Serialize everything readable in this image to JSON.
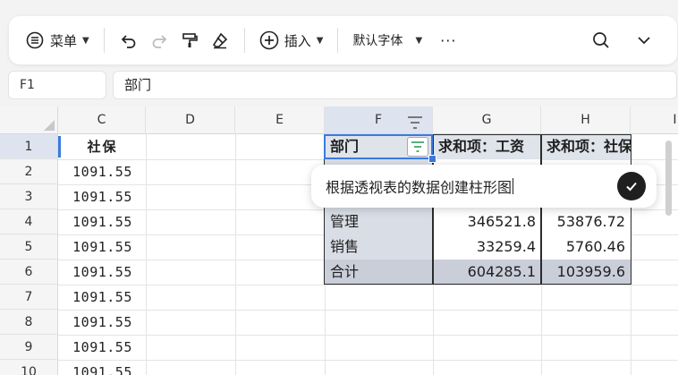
{
  "toolbar": {
    "menu_label": "菜单",
    "insert_label": "插入",
    "font_label": "默认字体",
    "more_label": "···"
  },
  "formula_bar": {
    "cell_ref": "F1",
    "content": "部门"
  },
  "columns": [
    "C",
    "D",
    "E",
    "F",
    "G",
    "H",
    "I"
  ],
  "rows": [
    "1",
    "2",
    "3",
    "4",
    "5",
    "6",
    "7",
    "8",
    "9",
    "10"
  ],
  "column_c": {
    "header": "社保",
    "values": [
      "1091.55",
      "1091.55",
      "1091.55",
      "1091.55",
      "1091.55",
      "1091.55",
      "1091.55",
      "1091.55",
      "1091.55"
    ]
  },
  "pivot": {
    "headers": [
      "部门",
      "求和项：工资",
      "求和项：社保"
    ],
    "rows": [
      {
        "dept": "管理",
        "salary": "346521.8",
        "social": "53876.72"
      },
      {
        "dept": "销售",
        "salary": "33259.4",
        "social": "5760.46"
      }
    ],
    "total": {
      "dept": "合计",
      "salary": "604285.1",
      "social": "103959.6"
    }
  },
  "ai_prompt": {
    "text": "根据透视表的数据创建柱形图"
  },
  "colors": {
    "accent": "#3b7ae0",
    "pivot_header": "#dfe3ea",
    "pivot_total": "#c9ced9"
  }
}
